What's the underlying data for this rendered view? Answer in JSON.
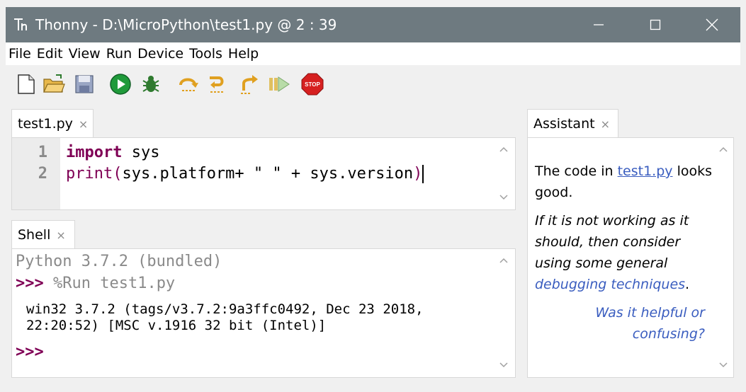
{
  "window": {
    "title": "Thonny  -  D:\\MicroPython\\test1.py  @  2 : 39",
    "minimize_icon": "minimize-icon",
    "maximize_icon": "maximize-icon",
    "close_icon": "close-icon"
  },
  "menu": [
    "File",
    "Edit",
    "View",
    "Run",
    "Device",
    "Tools",
    "Help"
  ],
  "toolbar": {
    "buttons": [
      "new-file-icon",
      "open-folder-icon",
      "save-icon",
      "run-icon",
      "debug-bug-icon",
      "step-over-icon",
      "step-into-icon",
      "step-out-icon",
      "resume-icon",
      "stop-icon"
    ],
    "stop_label": "STOP"
  },
  "editor": {
    "tab_label": "test1.py",
    "tab_close": "×",
    "lines": [
      {
        "number": "1",
        "keyword": "import",
        "rest": " sys"
      },
      {
        "number": "2",
        "func": "print",
        "open": "(",
        "body": "sys.platform+ \" \" + sys.version",
        "close": ")"
      }
    ]
  },
  "shell": {
    "tab_label": "Shell",
    "tab_close": "×",
    "banner": "Python 3.7.2 (bundled)",
    "prompt": ">>>",
    "command": " %Run test1.py",
    "output_line1": "win32 3.7.2 (tags/v3.7.2:9a3ffc0492, Dec 23 2018,",
    "output_line2": "22:20:52) [MSC v.1916 32 bit (Intel)]",
    "prompt2": ">>>"
  },
  "assistant": {
    "tab_label": "Assistant",
    "tab_close": "×",
    "line1_pre": "The code in ",
    "line1_link": "test1.py",
    "line1_post": " looks good.",
    "para2_italic": "If it is not working as it should, then consider using some general ",
    "para2_link": "debugging techniques",
    "para2_end": ".",
    "feedback_link": "Was it helpful or confusing?"
  },
  "colors": {
    "titlebar": "#6e7a80",
    "keyword": "#7f0055",
    "link": "#3a5dbf",
    "prompt": "#7f0055",
    "banner": "#8a8a8a"
  }
}
